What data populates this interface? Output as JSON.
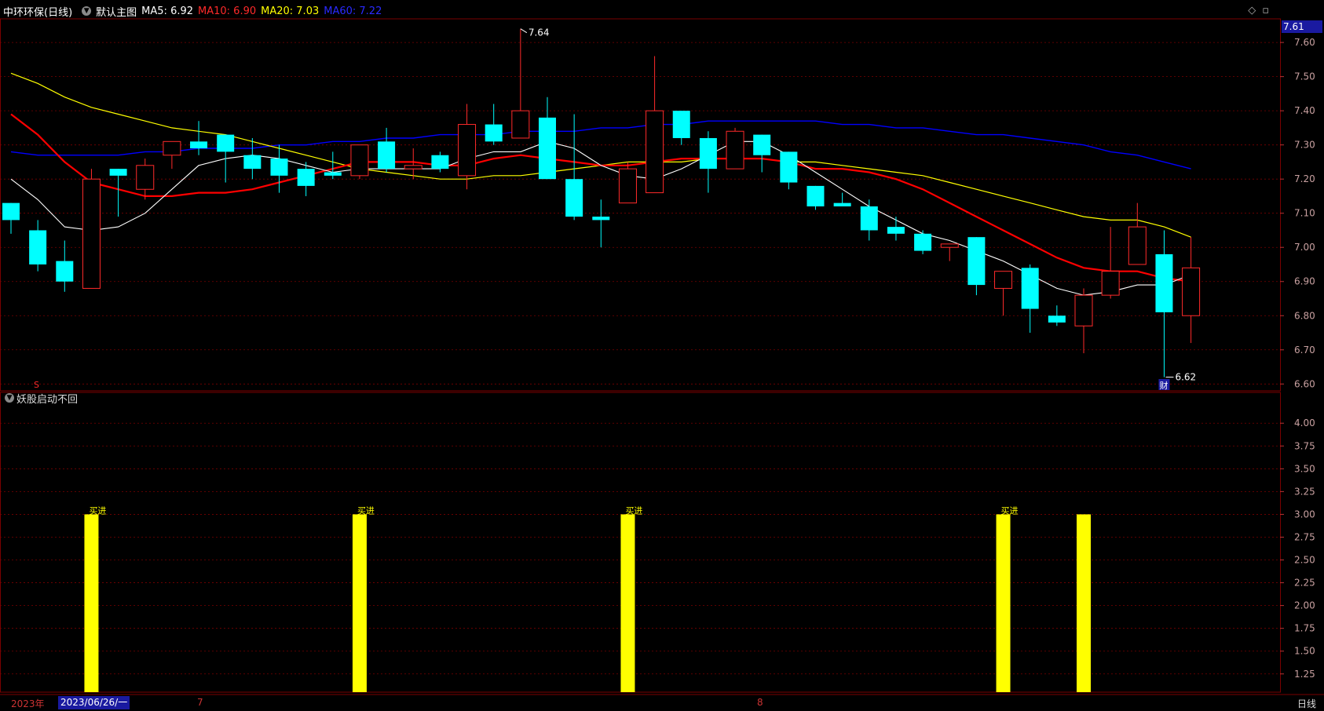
{
  "header": {
    "stock": "中环环保(日线)",
    "template": "默认主图",
    "ma5": "MA5: 6.92",
    "ma10": "MA10: 6.90",
    "ma20": "MA20: 7.03",
    "ma60": "MA60: 7.22",
    "icon_diamond": "◇",
    "icon_window": "▫"
  },
  "colors": {
    "up": "#ff2a2a",
    "down": "#00ffff",
    "ma5": "#ffffff",
    "ma10": "#ff0000",
    "ma20": "#ffff00",
    "ma60": "#0000ff",
    "bar": "#ffff00",
    "grid": "#7a0000"
  },
  "current_price": "7.61",
  "annotations": {
    "high": "7.64",
    "low": "6.62",
    "fin": "财",
    "s_mark": "S"
  },
  "y_axis_main": [
    "7.60",
    "7.50",
    "7.40",
    "7.30",
    "7.20",
    "7.10",
    "7.00",
    "6.90",
    "6.80",
    "6.70",
    "6.60"
  ],
  "y_axis_sub": [
    "4.00",
    "3.75",
    "3.50",
    "3.25",
    "3.00",
    "2.75",
    "2.50",
    "2.25",
    "2.00",
    "1.75",
    "1.50",
    "1.25"
  ],
  "indicator": {
    "name": "妖股启动不回",
    "signal_label": "买进"
  },
  "x_axis": {
    "year": "2023年",
    "date": "2023/06/26/一",
    "month7": "7",
    "month8": "8"
  },
  "period_button": "日线",
  "chart_data": {
    "type": "candlestick",
    "ylim": [
      6.58,
      7.66
    ],
    "candles": [
      [
        7.13,
        7.13,
        7.04,
        7.08
      ],
      [
        7.05,
        7.08,
        6.93,
        6.95
      ],
      [
        6.96,
        7.02,
        6.87,
        6.9
      ],
      [
        6.88,
        7.23,
        6.88,
        7.2
      ],
      [
        7.23,
        7.23,
        7.09,
        7.21
      ],
      [
        7.17,
        7.26,
        7.14,
        7.24
      ],
      [
        7.27,
        7.31,
        7.23,
        7.31
      ],
      [
        7.31,
        7.37,
        7.27,
        7.29
      ],
      [
        7.33,
        7.33,
        7.19,
        7.28
      ],
      [
        7.27,
        7.32,
        7.2,
        7.23
      ],
      [
        7.26,
        7.3,
        7.16,
        7.21
      ],
      [
        7.23,
        7.25,
        7.15,
        7.18
      ],
      [
        7.22,
        7.28,
        7.2,
        7.21
      ],
      [
        7.21,
        7.3,
        7.2,
        7.3
      ],
      [
        7.31,
        7.35,
        7.22,
        7.23
      ],
      [
        7.23,
        7.29,
        7.2,
        7.24
      ],
      [
        7.27,
        7.28,
        7.22,
        7.23
      ],
      [
        7.21,
        7.42,
        7.17,
        7.36
      ],
      [
        7.36,
        7.42,
        7.3,
        7.31
      ],
      [
        7.32,
        7.64,
        7.32,
        7.4
      ],
      [
        7.38,
        7.44,
        7.2,
        7.2
      ],
      [
        7.2,
        7.39,
        7.08,
        7.09
      ],
      [
        7.09,
        7.14,
        7.0,
        7.08
      ],
      [
        7.13,
        7.25,
        7.13,
        7.23
      ],
      [
        7.16,
        7.56,
        7.16,
        7.4
      ],
      [
        7.4,
        7.4,
        7.3,
        7.32
      ],
      [
        7.32,
        7.34,
        7.16,
        7.23
      ],
      [
        7.23,
        7.35,
        7.23,
        7.34
      ],
      [
        7.33,
        7.33,
        7.22,
        7.27
      ],
      [
        7.28,
        7.28,
        7.17,
        7.19
      ],
      [
        7.18,
        7.18,
        7.11,
        7.12
      ],
      [
        7.13,
        7.16,
        7.12,
        7.12
      ],
      [
        7.12,
        7.14,
        7.02,
        7.05
      ],
      [
        7.06,
        7.09,
        7.02,
        7.04
      ],
      [
        7.04,
        7.05,
        6.98,
        6.99
      ],
      [
        7.0,
        7.01,
        6.96,
        7.01
      ],
      [
        7.03,
        7.03,
        6.86,
        6.89
      ],
      [
        6.88,
        6.93,
        6.8,
        6.93
      ],
      [
        6.94,
        6.95,
        6.75,
        6.82
      ],
      [
        6.8,
        6.83,
        6.77,
        6.78
      ],
      [
        6.77,
        6.88,
        6.69,
        6.86
      ],
      [
        6.86,
        7.06,
        6.85,
        6.93
      ],
      [
        6.95,
        7.13,
        6.95,
        7.06
      ],
      [
        6.98,
        7.05,
        6.62,
        6.81
      ],
      [
        6.8,
        7.03,
        6.72,
        6.94
      ]
    ],
    "ma5": [
      7.2,
      7.14,
      7.06,
      7.05,
      7.06,
      7.1,
      7.17,
      7.24,
      7.26,
      7.27,
      7.26,
      7.24,
      7.22,
      7.23,
      7.23,
      7.23,
      7.23,
      7.26,
      7.28,
      7.28,
      7.31,
      7.29,
      7.24,
      7.21,
      7.2,
      7.23,
      7.27,
      7.31,
      7.31,
      7.27,
      7.22,
      7.17,
      7.12,
      7.08,
      7.04,
      7.02,
      6.99,
      6.96,
      6.92,
      6.88,
      6.86,
      6.87,
      6.89,
      6.89,
      6.92
    ],
    "ma10": [
      7.39,
      7.33,
      7.25,
      7.19,
      7.17,
      7.15,
      7.15,
      7.16,
      7.16,
      7.17,
      7.19,
      7.21,
      7.23,
      7.25,
      7.25,
      7.25,
      7.24,
      7.24,
      7.26,
      7.27,
      7.26,
      7.25,
      7.24,
      7.24,
      7.25,
      7.26,
      7.26,
      7.26,
      7.26,
      7.25,
      7.23,
      7.23,
      7.22,
      7.2,
      7.17,
      7.13,
      7.09,
      7.05,
      7.01,
      6.97,
      6.94,
      6.93,
      6.93,
      6.91,
      6.9
    ],
    "ma20": [
      7.51,
      7.48,
      7.44,
      7.41,
      7.39,
      7.37,
      7.35,
      7.34,
      7.33,
      7.31,
      7.29,
      7.27,
      7.25,
      7.23,
      7.22,
      7.21,
      7.2,
      7.2,
      7.21,
      7.21,
      7.22,
      7.23,
      7.24,
      7.25,
      7.25,
      7.25,
      7.26,
      7.26,
      7.26,
      7.25,
      7.25,
      7.24,
      7.23,
      7.22,
      7.21,
      7.19,
      7.17,
      7.15,
      7.13,
      7.11,
      7.09,
      7.08,
      7.08,
      7.06,
      7.03
    ],
    "ma60": [
      7.28,
      7.27,
      7.27,
      7.27,
      7.27,
      7.28,
      7.28,
      7.29,
      7.29,
      7.29,
      7.3,
      7.3,
      7.31,
      7.31,
      7.32,
      7.32,
      7.33,
      7.33,
      7.33,
      7.34,
      7.34,
      7.34,
      7.35,
      7.35,
      7.36,
      7.36,
      7.37,
      7.37,
      7.37,
      7.37,
      7.37,
      7.36,
      7.36,
      7.35,
      7.35,
      7.34,
      7.33,
      7.33,
      7.32,
      7.31,
      7.3,
      7.28,
      7.27,
      7.25,
      7.23
    ],
    "signals": {
      "ylim": [
        1.05,
        4.2
      ],
      "value": 3.0,
      "indices": [
        3,
        13,
        23,
        37,
        40
      ],
      "labeled": [
        3,
        13,
        23,
        37
      ]
    }
  }
}
